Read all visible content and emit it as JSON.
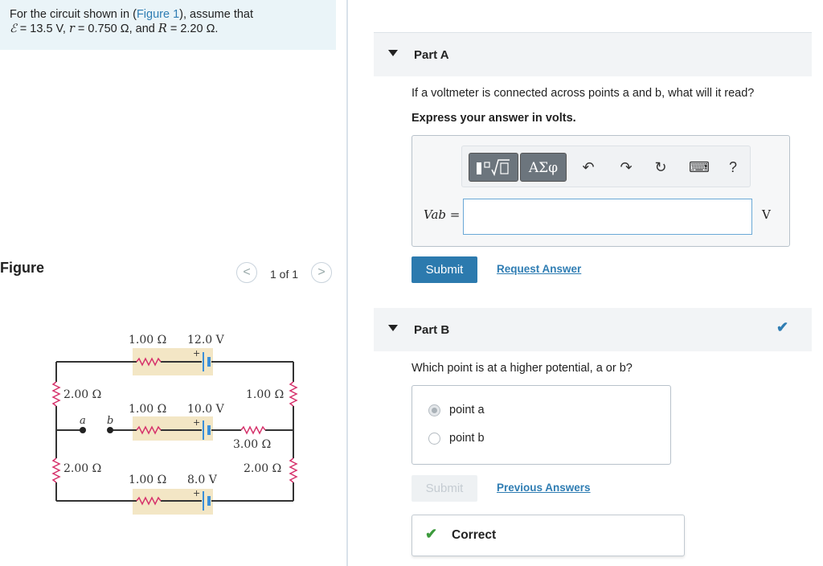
{
  "problem": {
    "line1_pre": "For the circuit shown in (",
    "figure_link": "Figure 1",
    "line1_post": "), assume that",
    "emf_symbol": "ℰ",
    "emf_value": " = 13.5 V, ",
    "r_symbol": "r",
    "r_value": " = 0.750 Ω, and ",
    "R_symbol": "R",
    "R_value": " = 2.20 Ω."
  },
  "figure": {
    "title": "Figure",
    "prev_label": "<",
    "next_label": ">",
    "pager_text": "1 of 1",
    "circuit": {
      "top_resistor": "1.00 Ω",
      "top_battery": "12.0 V",
      "mid_resistor": "1.00 Ω",
      "mid_battery": "10.0 V",
      "bot_resistor": "1.00 Ω",
      "bot_battery": "8.0 V",
      "left_upper": "2.00 Ω",
      "left_lower": "2.00 Ω",
      "right_upper": "1.00 Ω",
      "right_lower": "2.00 Ω",
      "mid_right": "3.00 Ω",
      "point_a": "a",
      "point_b": "b",
      "plus": "+"
    }
  },
  "partA": {
    "label": "Part A",
    "question": "If a voltmeter is connected across points a and b, what will it read?",
    "instruction": "Express your answer in volts.",
    "toolbar": {
      "templates_icon": "templates-icon",
      "greek_label": "ΑΣφ",
      "undo_icon": "↶",
      "redo_icon": "↷",
      "reset_icon": "↻",
      "keyboard_icon": "⌨",
      "help_label": "?"
    },
    "input_label": "Vab =",
    "input_value": "",
    "unit": "V",
    "submit_label": "Submit",
    "request_label": "Request Answer"
  },
  "partB": {
    "label": "Part B",
    "question": "Which point is at a higher potential, a or b?",
    "choices": [
      "point a",
      "point b"
    ],
    "selected_index": 0,
    "submit_label": "Submit",
    "previous_label": "Previous Answers",
    "result_label": "Correct"
  },
  "colors": {
    "accent": "#2c7aae",
    "correct": "#3c9a3c",
    "problem_bg": "#eaf4f8"
  }
}
